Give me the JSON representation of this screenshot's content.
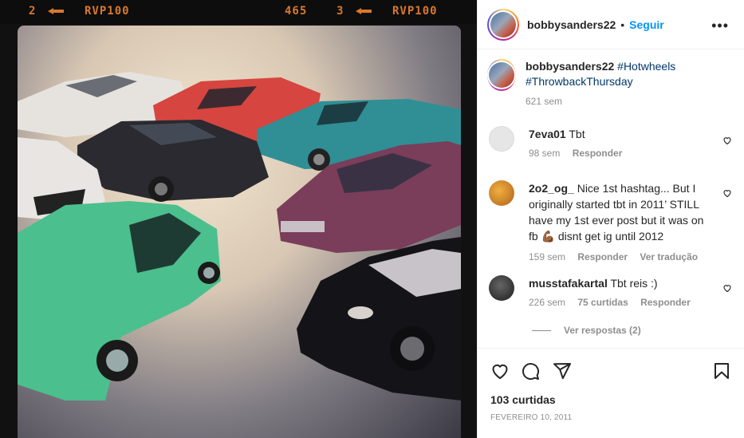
{
  "photo": {
    "film_left_num": "2",
    "film_left_label": "RVP100",
    "film_right_frame": "465",
    "film_right_num": "3",
    "film_right_label": "RVP100",
    "accent": "#d9782d"
  },
  "header": {
    "username": "bobbysanders22",
    "separator": "•",
    "follow_label": "Seguir",
    "more_label": "•••"
  },
  "caption": {
    "username": "bobbysanders22",
    "hashtag1": "#Hotwheels",
    "hashtag2": "#ThrowbackThursday",
    "time": "621 sem"
  },
  "comments": [
    {
      "username": "7eva01",
      "text": "Tbt",
      "time": "98 sem",
      "reply_label": "Responder",
      "avatar_color": "#dbdbdb"
    },
    {
      "username": "2o2_og_",
      "text": "Nice 1st hashtag... But I originally started tbt in 2011’ STILL have my 1st ever post but it was on fb 💪🏾 disnt get ig until 2012",
      "time": "159 sem",
      "reply_label": "Responder",
      "translate_label": "Ver tradução",
      "avatar_color": "#c8841f"
    },
    {
      "username": "musstafakartal",
      "text": "Tbt reis :)",
      "time": "226 sem",
      "likes": "75 curtidas",
      "reply_label": "Responder",
      "avatar_color": "#3a3a3a"
    }
  ],
  "view_replies_label": "Ver respostas (2)",
  "actions": {
    "icons": [
      "heart-icon",
      "comment-icon",
      "share-icon",
      "bookmark-icon"
    ],
    "likes": "103 curtidas",
    "date": "FEVEREIRO 10, 2011"
  },
  "colors": {
    "link": "#0095f6",
    "hashtag": "#00376b",
    "muted": "#8e8e8e",
    "border": "#efefef"
  }
}
